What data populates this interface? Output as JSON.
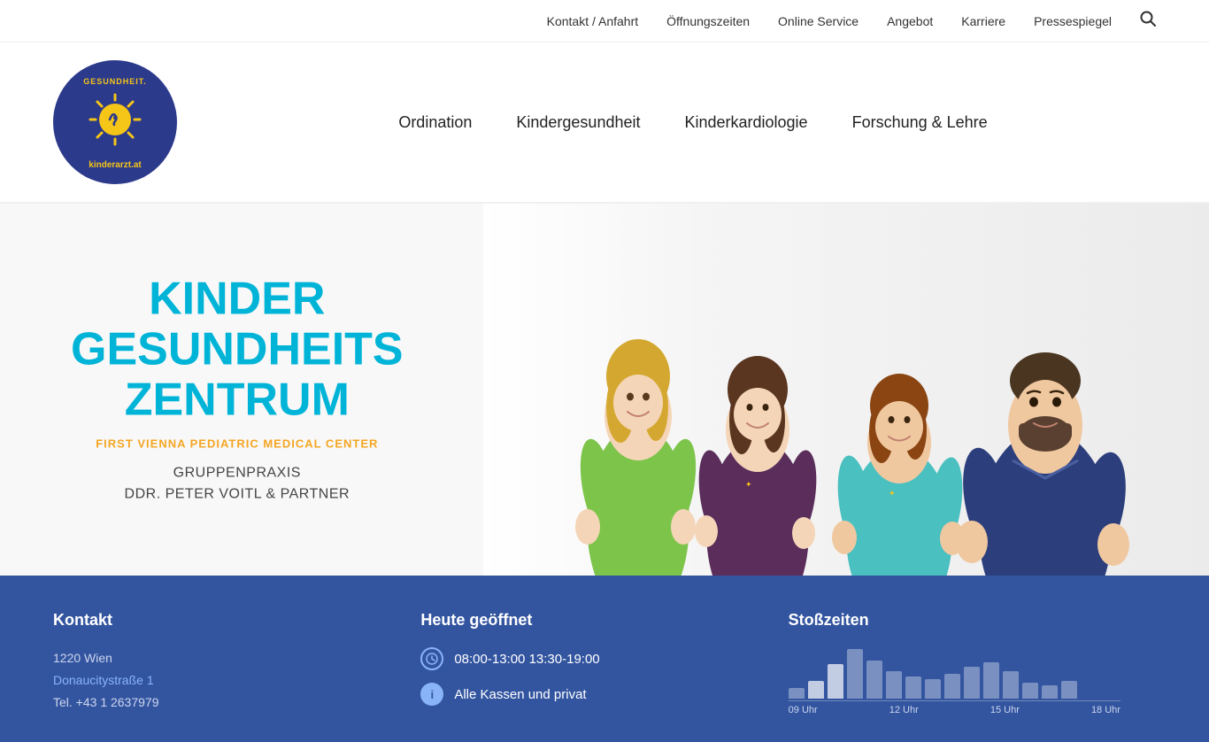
{
  "topnav": {
    "items": [
      {
        "label": "Kontakt / Anfahrt",
        "id": "kontakt-anfahrt"
      },
      {
        "label": "Öffnungszeiten",
        "id": "oeffnungszeiten"
      },
      {
        "label": "Online Service",
        "id": "online-service"
      },
      {
        "label": "Angebot",
        "id": "angebot"
      },
      {
        "label": "Karriere",
        "id": "karriere"
      },
      {
        "label": "Pressespiegel",
        "id": "pressespiegel"
      }
    ]
  },
  "mainnav": {
    "items": [
      {
        "label": "Ordination",
        "id": "ordination"
      },
      {
        "label": "Kindergesundheit",
        "id": "kindergesundheit"
      },
      {
        "label": "Kinderkardiologie",
        "id": "kinderkardiologie"
      },
      {
        "label": "Forschung & Lehre",
        "id": "forschung-lehre"
      }
    ]
  },
  "logo": {
    "alt": "Gesundheit Kinderarzt.at Logo",
    "text_top": "GESUNDHEIT.",
    "text_bottom": "kinderarzt.at"
  },
  "hero": {
    "title_line1": "KINDER",
    "title_line2": "GESUNDHEITS",
    "title_line3": "ZENTRUM",
    "subtitle": "FIRST VIENNA PEDIATRIC MEDICAL CENTER",
    "practice_line1": "GRUPPENPRAXIS",
    "practice_line2": "DDR. PETER VOITL & PARTNER"
  },
  "footer": {
    "kontakt": {
      "heading": "Kontakt",
      "address_city": "1220 Wien",
      "address_street": "Donaucitystraße 1",
      "phone": "Tel. +43 1 2637979"
    },
    "hours": {
      "heading": "Heute geöffnet",
      "time": "08:00-13:00  13:30-19:00",
      "insurance": "Alle Kassen und privat"
    },
    "stosszeiten": {
      "heading": "Stoßzeiten",
      "labels": [
        "09 Uhr",
        "12 Uhr",
        "15 Uhr",
        "18 Uhr"
      ],
      "bars": [
        12,
        20,
        38,
        55,
        42,
        30,
        25,
        22,
        28,
        35,
        40,
        30,
        18,
        15,
        20
      ]
    }
  }
}
